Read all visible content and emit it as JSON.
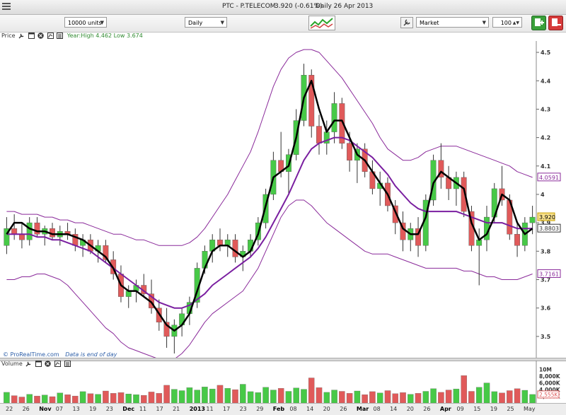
{
  "window": {
    "symbol": "PTC - P.TELECOM",
    "quote": "3.920 (-0.61%)",
    "period_date": "Daily  26 Apr 2013"
  },
  "toolbar": {
    "units": "10000 units",
    "interval": "Daily",
    "order_type": "Market",
    "quantity": "100"
  },
  "price_panel": {
    "label": "Price",
    "stats": "Year:High 4.462 Low 3.674",
    "attribution": "© ProRealTime.com",
    "data_note": "Data is end of day",
    "y_ticks": [
      "4.5",
      "4.4",
      "4.3",
      "4.2",
      "4.1",
      "4",
      "3.9",
      "3.8",
      "3.7",
      "3.6",
      "3.5"
    ],
    "last_price": "3.920",
    "ma_value": "3.8803",
    "upper_band_value": "4.0591",
    "lower_band_value": "3.7161",
    "colors": {
      "up": "#47c947",
      "down": "#e05a5a",
      "ma": "#7a1fa0",
      "bands": "#8a2a9a",
      "black_line": "#000000"
    }
  },
  "volume_panel": {
    "label": "Volume",
    "y_ticks": [
      "10M",
      "8,000K",
      "6,000K",
      "4,000K",
      "2,000K"
    ],
    "last_volume": "2,555K"
  },
  "x_axis": {
    "labels": [
      "22",
      "26",
      "Nov",
      "07",
      "13",
      "19",
      "23",
      "Dec",
      "11",
      "17",
      "21",
      "2013",
      "11",
      "17",
      "23",
      "29",
      "Feb",
      "08",
      "14",
      "20",
      "26",
      "Mar",
      "08",
      "14",
      "20",
      "26",
      "Apr",
      "09",
      "15",
      "19",
      "25",
      "May"
    ],
    "bold": [
      "Nov",
      "Dec",
      "2013",
      "Feb",
      "Mar",
      "Apr"
    ]
  },
  "chart_data": [
    {
      "type": "candlestick",
      "title": "Price",
      "ylim": [
        3.42,
        4.54
      ],
      "candles": [
        [
          3.82,
          3.92,
          3.79,
          3.88
        ],
        [
          3.88,
          3.93,
          3.84,
          3.86
        ],
        [
          3.86,
          3.9,
          3.81,
          3.84
        ],
        [
          3.84,
          3.92,
          3.82,
          3.9
        ],
        [
          3.9,
          3.92,
          3.85,
          3.86
        ],
        [
          3.86,
          3.89,
          3.82,
          3.88
        ],
        [
          3.88,
          3.9,
          3.84,
          3.85
        ],
        [
          3.85,
          3.89,
          3.82,
          3.87
        ],
        [
          3.87,
          3.9,
          3.84,
          3.86
        ],
        [
          3.86,
          3.88,
          3.8,
          3.82
        ],
        [
          3.82,
          3.86,
          3.78,
          3.84
        ],
        [
          3.84,
          3.86,
          3.79,
          3.8
        ],
        [
          3.8,
          3.84,
          3.76,
          3.82
        ],
        [
          3.82,
          3.84,
          3.76,
          3.77
        ],
        [
          3.77,
          3.8,
          3.7,
          3.72
        ],
        [
          3.72,
          3.75,
          3.62,
          3.64
        ],
        [
          3.64,
          3.68,
          3.6,
          3.66
        ],
        [
          3.66,
          3.7,
          3.62,
          3.68
        ],
        [
          3.68,
          3.72,
          3.64,
          3.65
        ],
        [
          3.65,
          3.7,
          3.58,
          3.6
        ],
        [
          3.6,
          3.63,
          3.52,
          3.55
        ],
        [
          3.55,
          3.6,
          3.46,
          3.5
        ],
        [
          3.5,
          3.56,
          3.44,
          3.54
        ],
        [
          3.54,
          3.6,
          3.5,
          3.58
        ],
        [
          3.58,
          3.64,
          3.54,
          3.62
        ],
        [
          3.62,
          3.76,
          3.6,
          3.74
        ],
        [
          3.74,
          3.82,
          3.72,
          3.8
        ],
        [
          3.8,
          3.86,
          3.76,
          3.84
        ],
        [
          3.84,
          3.88,
          3.8,
          3.82
        ],
        [
          3.82,
          3.86,
          3.78,
          3.84
        ],
        [
          3.84,
          3.86,
          3.76,
          3.78
        ],
        [
          3.78,
          3.82,
          3.73,
          3.8
        ],
        [
          3.8,
          3.86,
          3.78,
          3.84
        ],
        [
          3.84,
          3.92,
          3.82,
          3.9
        ],
        [
          3.9,
          4.02,
          3.88,
          4.0
        ],
        [
          4.0,
          4.15,
          3.98,
          4.12
        ],
        [
          4.12,
          4.22,
          4.06,
          4.08
        ],
        [
          4.08,
          4.16,
          4.0,
          4.14
        ],
        [
          4.14,
          4.3,
          4.12,
          4.26
        ],
        [
          4.26,
          4.46,
          4.24,
          4.42
        ],
        [
          4.42,
          4.44,
          4.2,
          4.24
        ],
        [
          4.24,
          4.28,
          4.14,
          4.18
        ],
        [
          4.18,
          4.26,
          4.14,
          4.22
        ],
        [
          4.22,
          4.36,
          4.18,
          4.32
        ],
        [
          4.32,
          4.34,
          4.16,
          4.18
        ],
        [
          4.18,
          4.22,
          4.08,
          4.12
        ],
        [
          4.12,
          4.18,
          4.04,
          4.16
        ],
        [
          4.16,
          4.18,
          4.06,
          4.08
        ],
        [
          4.08,
          4.12,
          4.0,
          4.02
        ],
        [
          4.02,
          4.08,
          3.96,
          4.04
        ],
        [
          4.04,
          4.06,
          3.94,
          3.96
        ],
        [
          3.96,
          3.98,
          3.86,
          3.9
        ],
        [
          3.9,
          3.94,
          3.8,
          3.84
        ],
        [
          3.84,
          3.9,
          3.8,
          3.88
        ],
        [
          3.88,
          3.92,
          3.78,
          3.82
        ],
        [
          3.82,
          4.0,
          3.8,
          3.98
        ],
        [
          3.98,
          4.14,
          3.96,
          4.12
        ],
        [
          4.12,
          4.18,
          4.02,
          4.06
        ],
        [
          4.06,
          4.1,
          3.98,
          4.02
        ],
        [
          4.02,
          4.08,
          3.96,
          4.06
        ],
        [
          4.06,
          4.08,
          3.92,
          3.94
        ],
        [
          3.94,
          3.96,
          3.8,
          3.82
        ],
        [
          3.82,
          3.88,
          3.68,
          3.84
        ],
        [
          3.84,
          3.96,
          3.8,
          3.92
        ],
        [
          3.92,
          4.04,
          3.9,
          4.02
        ],
        [
          4.02,
          4.1,
          3.96,
          3.98
        ],
        [
          3.98,
          4.0,
          3.84,
          3.86
        ],
        [
          3.86,
          3.9,
          3.78,
          3.82
        ],
        [
          3.82,
          3.92,
          3.8,
          3.9
        ],
        [
          3.9,
          3.96,
          3.86,
          3.92
        ]
      ],
      "series": [
        {
          "name": "",
          "style": "black-thick",
          "values": [
            3.86,
            3.9,
            3.9,
            3.88,
            3.87,
            3.87,
            3.86,
            3.86,
            3.86,
            3.85,
            3.84,
            3.82,
            3.8,
            3.78,
            3.74,
            3.68,
            3.66,
            3.66,
            3.64,
            3.62,
            3.58,
            3.54,
            3.52,
            3.54,
            3.58,
            3.66,
            3.74,
            3.8,
            3.82,
            3.82,
            3.8,
            3.78,
            3.8,
            3.86,
            3.96,
            4.06,
            4.08,
            4.1,
            4.2,
            4.34,
            4.4,
            4.3,
            4.22,
            4.26,
            4.26,
            4.2,
            4.14,
            4.12,
            4.08,
            4.04,
            4.0,
            3.94,
            3.88,
            3.86,
            3.86,
            3.92,
            4.04,
            4.08,
            4.06,
            4.04,
            4.02,
            3.9,
            3.84,
            3.86,
            3.92,
            4.0,
            3.98,
            3.9,
            3.86,
            3.88
          ]
        },
        {
          "name": "",
          "style": "ma",
          "values": [
            3.86,
            3.86,
            3.86,
            3.86,
            3.85,
            3.85,
            3.84,
            3.84,
            3.83,
            3.82,
            3.81,
            3.8,
            3.78,
            3.76,
            3.74,
            3.72,
            3.7,
            3.68,
            3.66,
            3.64,
            3.62,
            3.61,
            3.6,
            3.6,
            3.61,
            3.63,
            3.65,
            3.68,
            3.7,
            3.72,
            3.74,
            3.76,
            3.78,
            3.81,
            3.85,
            3.9,
            3.95,
            4.0,
            4.06,
            4.12,
            4.16,
            4.18,
            4.19,
            4.2,
            4.2,
            4.19,
            4.17,
            4.15,
            4.13,
            4.1,
            4.07,
            4.03,
            4.0,
            3.97,
            3.95,
            3.94,
            3.94,
            3.94,
            3.94,
            3.94,
            3.93,
            3.92,
            3.91,
            3.9,
            3.9,
            3.9,
            3.89,
            3.88,
            3.88,
            3.88
          ]
        },
        {
          "name": "",
          "style": "band-upper",
          "values": [
            3.94,
            3.94,
            3.93,
            3.93,
            3.93,
            3.92,
            3.92,
            3.91,
            3.91,
            3.9,
            3.9,
            3.89,
            3.88,
            3.87,
            3.86,
            3.86,
            3.85,
            3.84,
            3.84,
            3.83,
            3.82,
            3.82,
            3.82,
            3.82,
            3.83,
            3.85,
            3.88,
            3.92,
            3.96,
            4.0,
            4.05,
            4.1,
            4.15,
            4.22,
            4.3,
            4.38,
            4.44,
            4.48,
            4.5,
            4.51,
            4.51,
            4.5,
            4.47,
            4.44,
            4.41,
            4.37,
            4.33,
            4.29,
            4.25,
            4.2,
            4.16,
            4.14,
            4.12,
            4.12,
            4.13,
            4.15,
            4.16,
            4.17,
            4.17,
            4.17,
            4.16,
            4.15,
            4.14,
            4.13,
            4.12,
            4.11,
            4.1,
            4.08,
            4.07,
            4.06
          ]
        },
        {
          "name": "",
          "style": "band-lower",
          "values": [
            3.7,
            3.7,
            3.71,
            3.71,
            3.72,
            3.72,
            3.71,
            3.7,
            3.68,
            3.65,
            3.62,
            3.59,
            3.56,
            3.53,
            3.51,
            3.48,
            3.46,
            3.45,
            3.44,
            3.43,
            3.42,
            3.42,
            3.42,
            3.44,
            3.47,
            3.51,
            3.55,
            3.58,
            3.6,
            3.62,
            3.64,
            3.66,
            3.7,
            3.74,
            3.8,
            3.86,
            3.92,
            3.96,
            3.98,
            3.98,
            3.96,
            3.93,
            3.9,
            3.88,
            3.86,
            3.84,
            3.82,
            3.8,
            3.79,
            3.79,
            3.79,
            3.78,
            3.77,
            3.76,
            3.75,
            3.74,
            3.74,
            3.74,
            3.74,
            3.74,
            3.73,
            3.73,
            3.72,
            3.71,
            3.71,
            3.7,
            3.7,
            3.7,
            3.71,
            3.72
          ]
        }
      ]
    },
    {
      "type": "bar",
      "title": "Volume",
      "ylim": [
        0,
        11000
      ],
      "unit": "K",
      "values": [
        3200,
        2200,
        1800,
        2600,
        2100,
        2400,
        1900,
        3000,
        2500,
        2100,
        3400,
        2800,
        2600,
        3600,
        2900,
        3100,
        2700,
        2500,
        2300,
        3300,
        2900,
        5300,
        4100,
        3700,
        4600,
        3900,
        4800,
        4200,
        5300,
        4400,
        4000,
        5600,
        3400,
        3100,
        4700,
        3900,
        4400,
        3500,
        4500,
        4100,
        7500,
        4600,
        3200,
        3900,
        3500,
        2900,
        3600,
        2500,
        3400,
        3000,
        3700,
        2800,
        3100,
        2600,
        2900,
        3500,
        4300,
        3200,
        3900,
        4200,
        8200,
        3500,
        4700,
        6000,
        3400,
        3000,
        3700,
        4300,
        3800,
        2555
      ],
      "colors": [
        "#47c947",
        "#e05a5a"
      ]
    }
  ]
}
